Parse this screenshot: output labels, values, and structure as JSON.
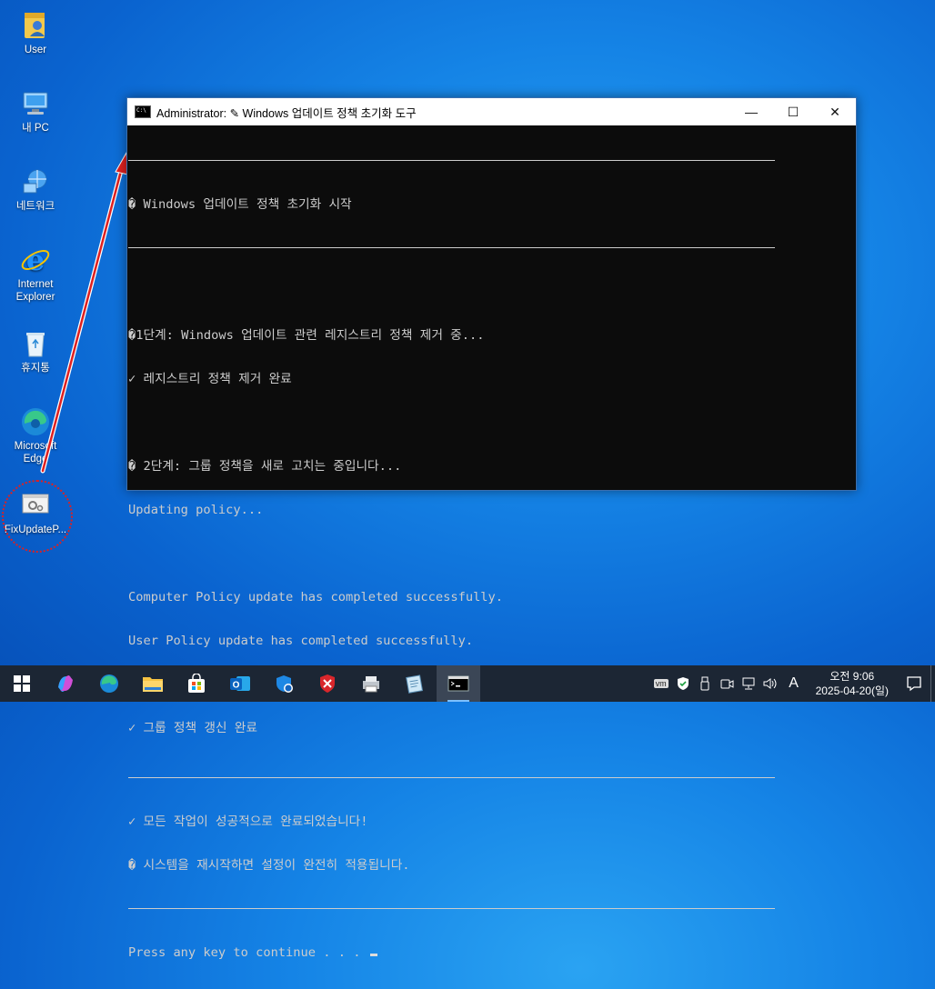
{
  "desktop": {
    "icons": [
      {
        "label": "User"
      },
      {
        "label": "내 PC"
      },
      {
        "label": "네트워크"
      },
      {
        "label": "Internet Explorer"
      },
      {
        "label": "휴지통"
      },
      {
        "label": "Microsoft Edge"
      },
      {
        "label": "FixUpdateP..."
      }
    ]
  },
  "window": {
    "title": "Administrator:  ✎ Windows 업데이트 정책 초기화 도구",
    "controls": {
      "minimize": "—",
      "maximize": "☐",
      "close": "✕"
    }
  },
  "console": {
    "header": "� Windows 업데이트 정책 초기화 시작",
    "step1": "�1단계: Windows 업데이트 관련 레지스트리 정책 제거 중...",
    "step1_done": "✓ 레지스트리 정책 제거 완료",
    "step2": "� 2단계: 그룹 정책을 새로 고치는 중입니다...",
    "updating": "Updating policy...",
    "computer_policy": "Computer Policy update has completed successfully.",
    "user_policy": "User Policy update has completed successfully.",
    "step2_done": "✓ 그룹 정책 갱신 완료",
    "all_done": "✓ 모든 작업이 성공적으로 완료되었습니다!",
    "restart_note": "� 시스템을 재시작하면 설정이 완전히 적용됩니다.",
    "prompt": "Press any key to continue . . . "
  },
  "taskbar": {
    "apps": [
      "start-icon",
      "copilot-icon",
      "edge-icon",
      "file-explorer-icon",
      "store-icon",
      "outlook-icon",
      "defender-icon",
      "security-shield-icon",
      "printer-icon",
      "notepad-icon",
      "terminal-icon"
    ],
    "tray": {
      "vm_label": "vm",
      "ime": "A"
    },
    "clock": {
      "time": "오전 9:06",
      "date": "2025-04-20(일)"
    }
  },
  "colors": {
    "annotation": "#e02020",
    "console_bg": "#0c0c0c",
    "console_fg": "#cccccc"
  }
}
